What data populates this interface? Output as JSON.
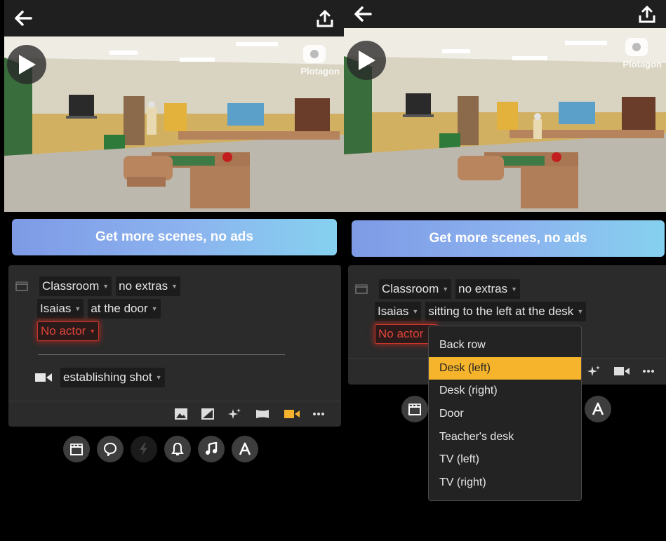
{
  "promo_label": "Get more scenes, no ads",
  "watermark": "Plotagon",
  "left": {
    "location": "Classroom",
    "extras": "no extras",
    "actor1_name": "Isaias",
    "actor1_position": "at the door",
    "actor2": "No actor",
    "shot": "establishing shot"
  },
  "right": {
    "location": "Classroom",
    "extras": "no extras",
    "actor1_name": "Isaias",
    "actor1_position": "sitting to the left at the desk",
    "actor2": "No actor",
    "dropdown": {
      "options": [
        "Back row",
        "Desk (left)",
        "Desk (right)",
        "Door",
        "Teacher's desk",
        "TV (left)",
        "TV (right)"
      ],
      "selected": "Desk (left)"
    }
  },
  "colors": {
    "accent": "#f5b42b",
    "warning": "#e0443a",
    "panel": "#2b2b2b"
  },
  "icons": [
    "back-arrow-icon",
    "share-icon",
    "play-icon",
    "clapperboard-icon",
    "camera-icon",
    "image-icon",
    "contrast-icon",
    "sparkle-icon",
    "panorama-icon",
    "more-icon",
    "speech-bubble-icon",
    "lightning-icon",
    "bell-icon",
    "music-icon",
    "text-icon"
  ]
}
